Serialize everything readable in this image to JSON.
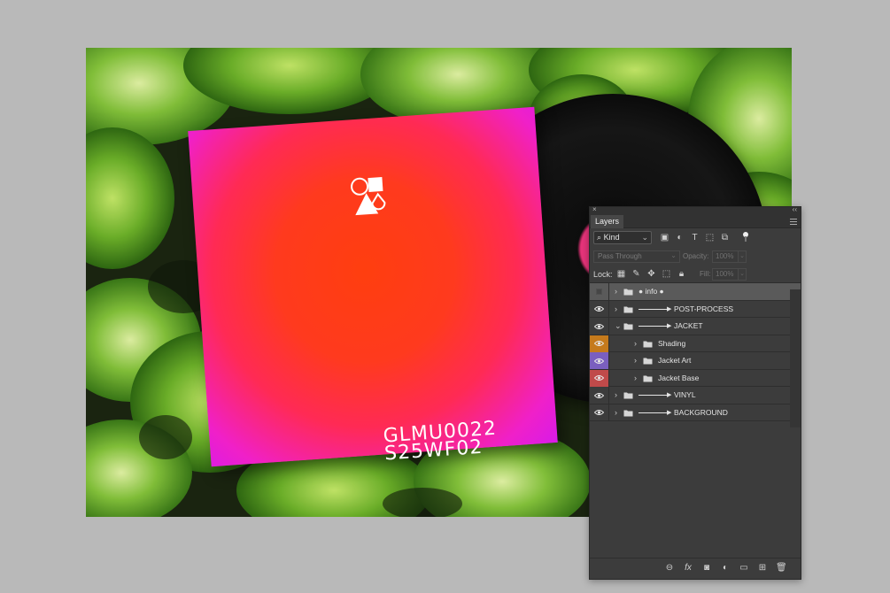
{
  "jacket": {
    "catalog_line1": "GLMU0022",
    "catalog_line2": "S25WF02"
  },
  "panel": {
    "tab_title": "Layers",
    "close_glyph": "×",
    "collapse_glyph": "‹‹",
    "filter": {
      "kind_label": "Kind",
      "icons": [
        "image-filter-icon",
        "adjustment-filter-icon",
        "type-filter-icon",
        "shape-filter-icon",
        "smart-object-filter-icon"
      ]
    },
    "blend_mode": "Pass Through",
    "opacity_label": "Opacity:",
    "opacity_value": "100%",
    "lock_label": "Lock:",
    "lock_icons": [
      "lock-transparent-icon",
      "lock-image-icon",
      "lock-position-icon",
      "lock-artboard-icon",
      "lock-all-icon"
    ],
    "fill_label": "Fill:",
    "fill_value": "100%",
    "layers": [
      {
        "name": "● info ●",
        "visible": false,
        "expanded": false,
        "indent": 0,
        "color": null,
        "arrow": false,
        "selected": true
      },
      {
        "name": "POST-PROCESS",
        "visible": true,
        "expanded": false,
        "indent": 0,
        "color": null,
        "arrow": true,
        "selected": false
      },
      {
        "name": "JACKET",
        "visible": true,
        "expanded": true,
        "indent": 0,
        "color": null,
        "arrow": true,
        "selected": false
      },
      {
        "name": "Shading",
        "visible": true,
        "expanded": false,
        "indent": 1,
        "color": "#c57a1c",
        "arrow": false,
        "selected": false
      },
      {
        "name": "Jacket Art",
        "visible": true,
        "expanded": false,
        "indent": 1,
        "color": "#7a5fbf",
        "arrow": false,
        "selected": false
      },
      {
        "name": "Jacket Base",
        "visible": true,
        "expanded": false,
        "indent": 1,
        "color": "#c04a4a",
        "arrow": false,
        "selected": false
      },
      {
        "name": "VINYL",
        "visible": true,
        "expanded": false,
        "indent": 0,
        "color": null,
        "arrow": true,
        "selected": false
      },
      {
        "name": "BACKGROUND",
        "visible": true,
        "expanded": false,
        "indent": 0,
        "color": null,
        "arrow": true,
        "selected": false
      }
    ],
    "bottom_icons": [
      "link-layers-icon",
      "fx-icon",
      "add-mask-icon",
      "new-adjustment-icon",
      "new-group-icon",
      "new-layer-icon",
      "delete-layer-icon"
    ]
  }
}
